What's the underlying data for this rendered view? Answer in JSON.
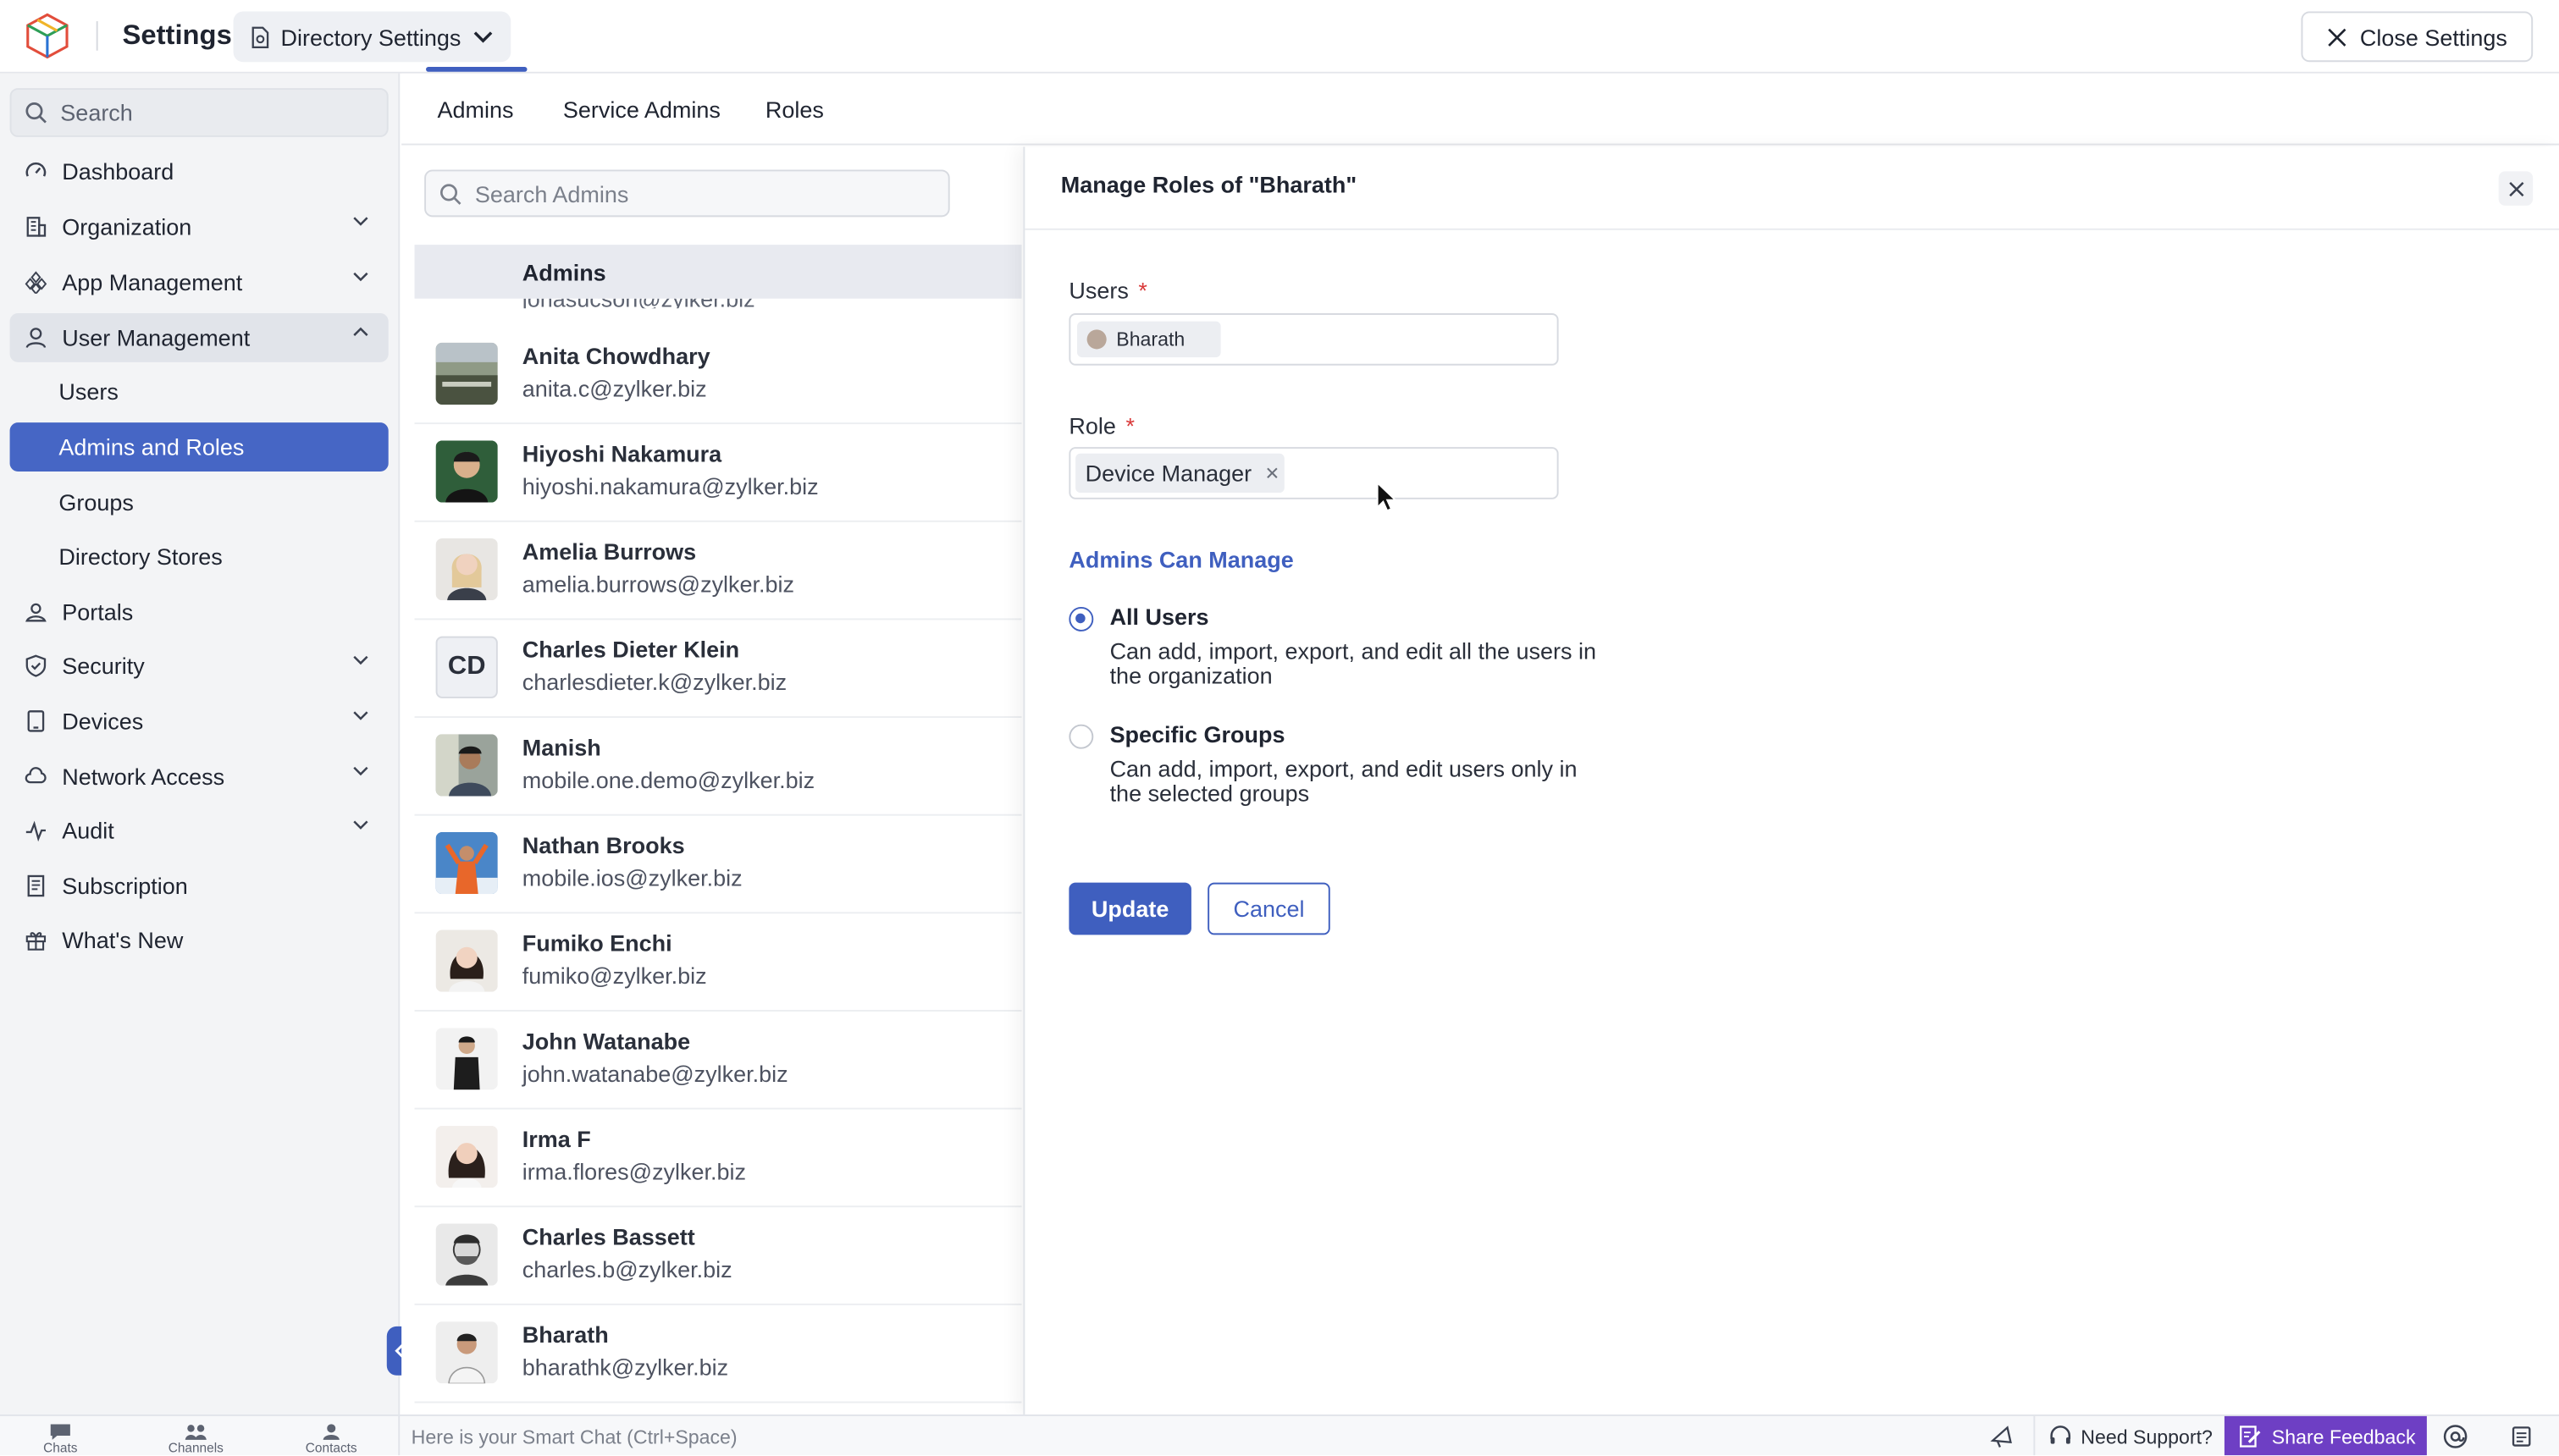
{
  "header": {
    "app_title": "Settings",
    "directory_button": "Directory Settings",
    "close_settings": "Close Settings"
  },
  "sidebar": {
    "search_placeholder": "Search",
    "items": [
      {
        "label": "Dashboard",
        "icon": "dashboard-icon"
      },
      {
        "label": "Organization",
        "icon": "organization-icon"
      },
      {
        "label": "App Management",
        "icon": "app-management-icon"
      },
      {
        "label": "User Management",
        "icon": "user-icon",
        "expanded": true
      },
      {
        "label": "Users",
        "sub": true
      },
      {
        "label": "Admins and Roles",
        "sub": true,
        "active": true
      },
      {
        "label": "Groups",
        "sub": true
      },
      {
        "label": "Directory Stores",
        "sub": true
      },
      {
        "label": "Portals",
        "icon": "portals-icon"
      },
      {
        "label": "Security",
        "icon": "shield-icon"
      },
      {
        "label": "Devices",
        "icon": "devices-icon"
      },
      {
        "label": "Network Access",
        "icon": "cloud-icon"
      },
      {
        "label": "Audit",
        "icon": "audit-icon"
      },
      {
        "label": "Subscription",
        "icon": "subscription-icon"
      },
      {
        "label": "What's New",
        "icon": "gift-icon"
      }
    ]
  },
  "tabs": {
    "items": [
      {
        "label": "Admins",
        "active": true
      },
      {
        "label": "Service Admins"
      },
      {
        "label": "Roles"
      }
    ]
  },
  "admin_list": {
    "search_placeholder": "Search Admins",
    "group_header": "Admins",
    "partial_email": "jonasucson@zylker.biz",
    "rows": [
      {
        "name": "Anita Chowdhary",
        "email": "anita.c@zylker.biz"
      },
      {
        "name": "Hiyoshi Nakamura",
        "email": "hiyoshi.nakamura@zylker.biz"
      },
      {
        "name": "Amelia Burrows",
        "email": "amelia.burrows@zylker.biz"
      },
      {
        "name": "Charles Dieter Klein",
        "email": "charlesdieter.k@zylker.biz",
        "initials": "CD"
      },
      {
        "name": "Manish",
        "email": "mobile.one.demo@zylker.biz"
      },
      {
        "name": "Nathan Brooks",
        "email": "mobile.ios@zylker.biz"
      },
      {
        "name": "Fumiko Enchi",
        "email": "fumiko@zylker.biz"
      },
      {
        "name": "John Watanabe",
        "email": "john.watanabe@zylker.biz"
      },
      {
        "name": "Irma F",
        "email": "irma.flores@zylker.biz"
      },
      {
        "name": "Charles Bassett",
        "email": "charles.b@zylker.biz"
      },
      {
        "name": "Bharath",
        "email": "bharathk@zylker.biz"
      }
    ]
  },
  "manage_panel": {
    "title": "Manage Roles of \"Bharath\"",
    "users_label": "Users",
    "users_chip": "Bharath",
    "role_label": "Role",
    "role_chip": "Device Manager",
    "section_title": "Admins Can Manage",
    "options": [
      {
        "title": "All Users",
        "desc": "Can add, import, export, and edit all the users in the organization",
        "selected": true
      },
      {
        "title": "Specific Groups",
        "desc": "Can add, import, export, and edit users only in the selected groups",
        "selected": false
      }
    ],
    "update_label": "Update",
    "cancel_label": "Cancel",
    "required_mark": "*"
  },
  "bottombar": {
    "nav": [
      "Chats",
      "Channels",
      "Contacts"
    ],
    "smart_chat": "Here is your Smart Chat (Ctrl+Space)",
    "need_support": "Need Support?",
    "share_feedback": "Share Feedback"
  },
  "colors": {
    "accent": "#3f5fbf",
    "active_nav": "#4666c5",
    "feedback": "#6e3fc4",
    "required": "#d93a3a"
  }
}
